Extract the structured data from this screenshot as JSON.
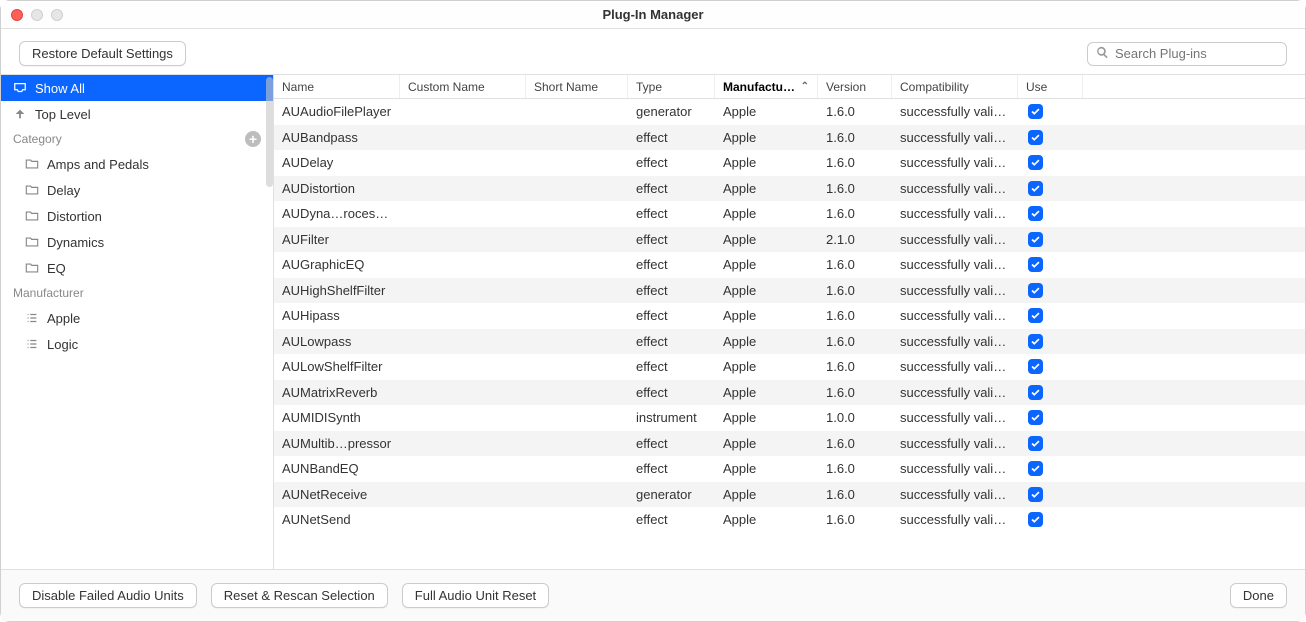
{
  "window": {
    "title": "Plug-In Manager"
  },
  "toolbar": {
    "restore_label": "Restore Default Settings"
  },
  "search": {
    "placeholder": "Search Plug-ins"
  },
  "sidebar": {
    "show_all": "Show All",
    "top_level": "Top Level",
    "category_header": "Category",
    "categories": [
      {
        "label": "Amps and Pedals"
      },
      {
        "label": "Delay"
      },
      {
        "label": "Distortion"
      },
      {
        "label": "Dynamics"
      },
      {
        "label": "EQ"
      }
    ],
    "manufacturer_header": "Manufacturer",
    "manufacturers": [
      {
        "label": "Apple"
      },
      {
        "label": "Logic"
      }
    ]
  },
  "table": {
    "columns": {
      "name": "Name",
      "custom": "Custom Name",
      "short": "Short Name",
      "type": "Type",
      "manufacturer": "Manufactu…",
      "version": "Version",
      "compat": "Compatibility",
      "use": "Use"
    },
    "rows": [
      {
        "name": "AUAudioFilePlayer",
        "custom": "",
        "short": "",
        "type": "generator",
        "manufacturer": "Apple",
        "version": "1.6.0",
        "compat": "successfully vali…",
        "use": true
      },
      {
        "name": "AUBandpass",
        "custom": "",
        "short": "",
        "type": "effect",
        "manufacturer": "Apple",
        "version": "1.6.0",
        "compat": "successfully vali…",
        "use": true
      },
      {
        "name": "AUDelay",
        "custom": "",
        "short": "",
        "type": "effect",
        "manufacturer": "Apple",
        "version": "1.6.0",
        "compat": "successfully vali…",
        "use": true
      },
      {
        "name": "AUDistortion",
        "custom": "",
        "short": "",
        "type": "effect",
        "manufacturer": "Apple",
        "version": "1.6.0",
        "compat": "successfully vali…",
        "use": true
      },
      {
        "name": "AUDyna…rocessor",
        "custom": "",
        "short": "",
        "type": "effect",
        "manufacturer": "Apple",
        "version": "1.6.0",
        "compat": "successfully vali…",
        "use": true
      },
      {
        "name": "AUFilter",
        "custom": "",
        "short": "",
        "type": "effect",
        "manufacturer": "Apple",
        "version": "2.1.0",
        "compat": "successfully vali…",
        "use": true
      },
      {
        "name": "AUGraphicEQ",
        "custom": "",
        "short": "",
        "type": "effect",
        "manufacturer": "Apple",
        "version": "1.6.0",
        "compat": "successfully vali…",
        "use": true
      },
      {
        "name": "AUHighShelfFilter",
        "custom": "",
        "short": "",
        "type": "effect",
        "manufacturer": "Apple",
        "version": "1.6.0",
        "compat": "successfully vali…",
        "use": true
      },
      {
        "name": "AUHipass",
        "custom": "",
        "short": "",
        "type": "effect",
        "manufacturer": "Apple",
        "version": "1.6.0",
        "compat": "successfully vali…",
        "use": true
      },
      {
        "name": "AULowpass",
        "custom": "",
        "short": "",
        "type": "effect",
        "manufacturer": "Apple",
        "version": "1.6.0",
        "compat": "successfully vali…",
        "use": true
      },
      {
        "name": "AULowShelfFilter",
        "custom": "",
        "short": "",
        "type": "effect",
        "manufacturer": "Apple",
        "version": "1.6.0",
        "compat": "successfully vali…",
        "use": true
      },
      {
        "name": "AUMatrixReverb",
        "custom": "",
        "short": "",
        "type": "effect",
        "manufacturer": "Apple",
        "version": "1.6.0",
        "compat": "successfully vali…",
        "use": true
      },
      {
        "name": "AUMIDISynth",
        "custom": "",
        "short": "",
        "type": "instrument",
        "manufacturer": "Apple",
        "version": "1.0.0",
        "compat": "successfully vali…",
        "use": true
      },
      {
        "name": "AUMultib…pressor",
        "custom": "",
        "short": "",
        "type": "effect",
        "manufacturer": "Apple",
        "version": "1.6.0",
        "compat": "successfully vali…",
        "use": true
      },
      {
        "name": "AUNBandEQ",
        "custom": "",
        "short": "",
        "type": "effect",
        "manufacturer": "Apple",
        "version": "1.6.0",
        "compat": "successfully vali…",
        "use": true
      },
      {
        "name": "AUNetReceive",
        "custom": "",
        "short": "",
        "type": "generator",
        "manufacturer": "Apple",
        "version": "1.6.0",
        "compat": "successfully vali…",
        "use": true
      },
      {
        "name": "AUNetSend",
        "custom": "",
        "short": "",
        "type": "effect",
        "manufacturer": "Apple",
        "version": "1.6.0",
        "compat": "successfully vali…",
        "use": true
      }
    ]
  },
  "footer": {
    "disable_failed": "Disable Failed Audio Units",
    "reset_rescan": "Reset & Rescan Selection",
    "full_reset": "Full Audio Unit Reset",
    "done": "Done"
  }
}
